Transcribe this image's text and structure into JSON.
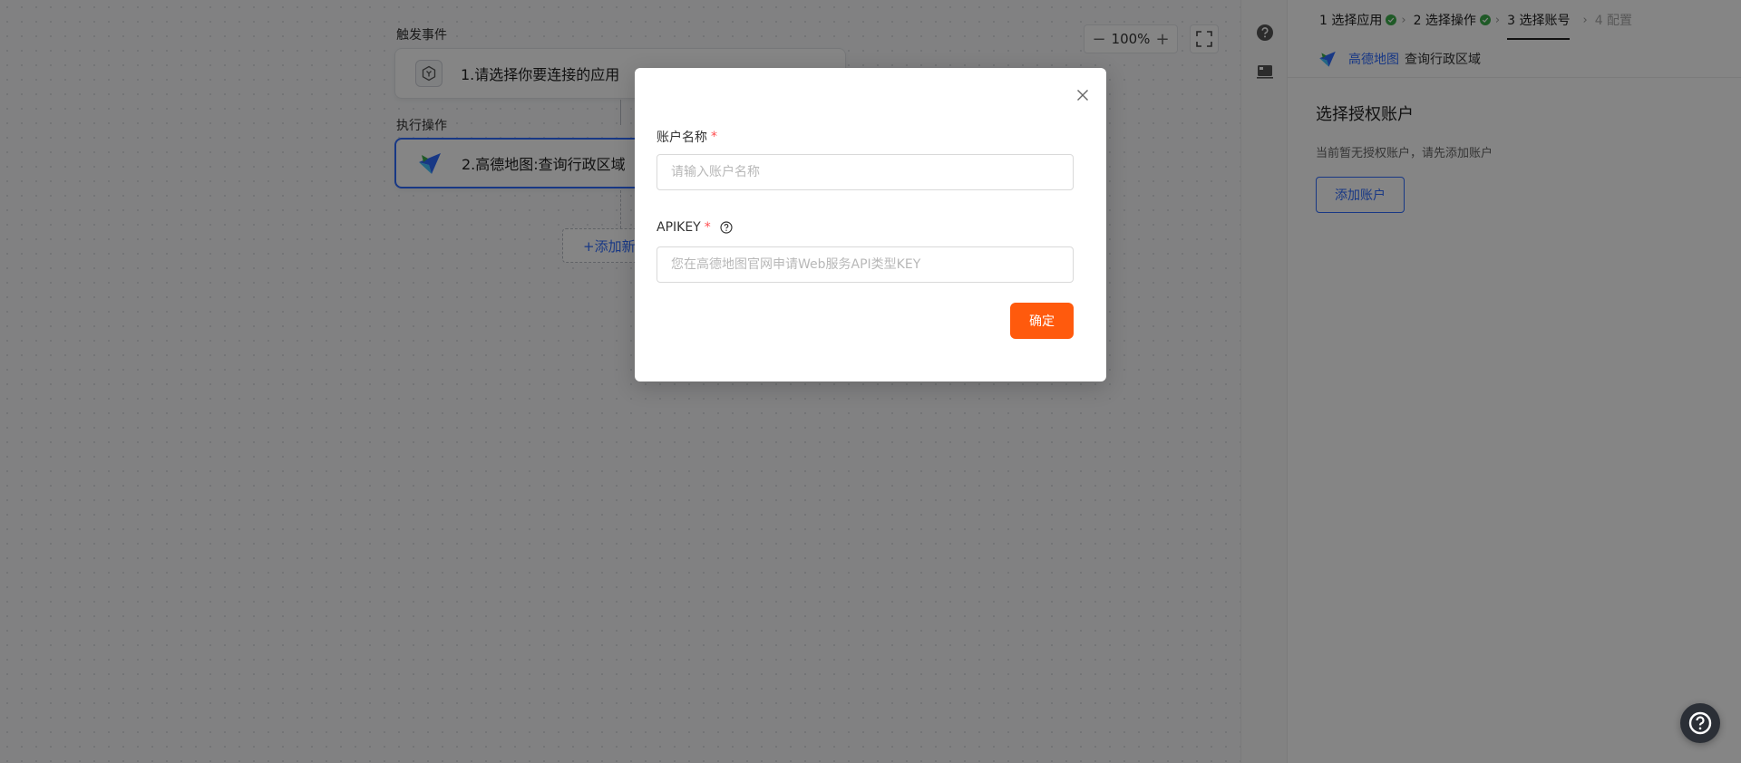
{
  "canvas": {
    "trigger_section_label": "触发事件",
    "trigger_node_title": "1.请选择你要连接的应用",
    "action_section_label": "执行操作",
    "action_node_title": "2.高德地图:查询行政区域",
    "add_step_label": "+添加新",
    "zoom": {
      "minus": "−",
      "value": "100%",
      "plus": "+"
    }
  },
  "panel": {
    "steps": [
      {
        "label": "1 选择应用",
        "state": "done"
      },
      {
        "label": "2 选择操作",
        "state": "done"
      },
      {
        "label": "3 选择账号",
        "state": "current"
      },
      {
        "label": "4 配置",
        "state": "disabled"
      }
    ],
    "app_name": "高德地图",
    "action_name": "查询行政区域",
    "title": "选择授权账户",
    "hint": "当前暂无授权账户，请先添加账户",
    "add_account_label": "添加账户"
  },
  "modal": {
    "account_name_label": "账户名称",
    "account_name_placeholder": "请输入账户名称",
    "account_name_value": "",
    "apikey_label": "APIKEY",
    "apikey_placeholder": "您在高德地图官网申请Web服务API类型KEY",
    "apikey_value": "",
    "required_mark": "*",
    "confirm_label": "确定"
  },
  "colors": {
    "accent": "#2f6bff",
    "confirm": "#ff5a0d",
    "success": "#3dad4b",
    "required": "#ff4d4f"
  },
  "icons": {
    "trigger": "hexagon-app-icon",
    "amap": "amap-logo-icon",
    "close": "close-icon",
    "help": "question-circle-icon",
    "fullscreen": "fullscreen-icon"
  }
}
